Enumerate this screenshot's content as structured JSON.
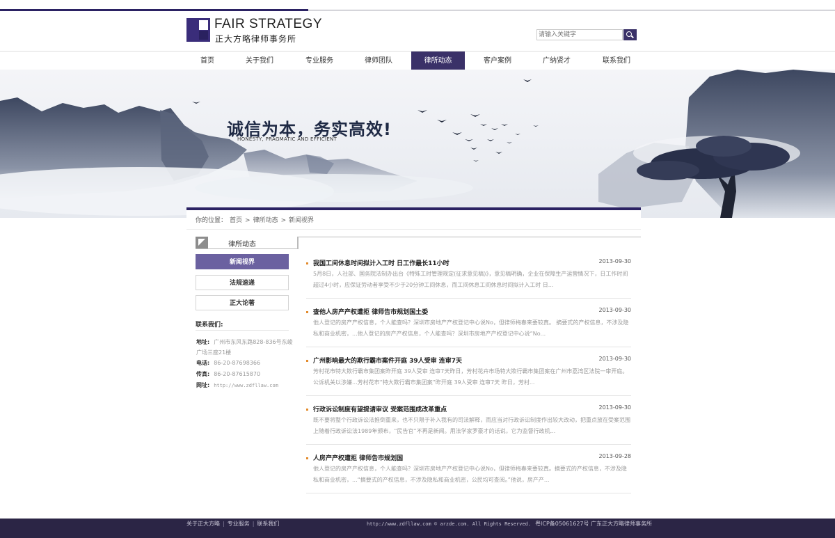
{
  "header": {
    "logo_en": "FAIR STRATEGY",
    "logo_cn": "正大方略律师事务所",
    "search_placeholder": "请输入关键字"
  },
  "nav": {
    "items": [
      "首页",
      "关于我们",
      "专业服务",
      "律师团队",
      "律所动态",
      "客户案例",
      "广纳贤才",
      "联系我们"
    ],
    "active": "律所动态"
  },
  "banner": {
    "slogan": "诚信为本，务实高效!",
    "slogan_en": "HONESTY, PRAGMATIC AND EFFICIENT"
  },
  "breadcrumb": [
    "你的位置：",
    "首页",
    ">",
    "律所动态",
    ">",
    "新闻视界"
  ],
  "sidebar": {
    "title": "律所动态",
    "items": [
      "新闻视界",
      "法规速递",
      "正大论著"
    ],
    "active": "新闻视界",
    "contact": {
      "title": "联系我们:",
      "address_label": "地址:",
      "address": "广州市东风东路828-836号东峻广场三座21楼",
      "phone_label": "电话:",
      "phone": "86-20-87698366",
      "fax_label": "传真:",
      "fax": "86-20-87615870",
      "web_label": "网址:",
      "web": "http://www.zdfllaw.com"
    }
  },
  "news": [
    {
      "title": "我国工间休息时间拟计入工时  日工作最长11小时",
      "date": "2013-09-30",
      "summary": "5月8日，人社部、国务院法制办出台《特殊工时管理规定(征求意见稿)》，意见稿明确，企业在保障生产运营情况下，日工作时间超过4小时，应保证劳动者享受不少于20分钟工间休息，而工间休息工间休息时间拟计入工时 日..."
    },
    {
      "title": "查他人房产产权遭拒  律师告市规划国土委",
      "date": "2013-09-30",
      "summary": "他人登记的房产产权信息，个人能查吗？深圳市房地产产权登记中心说No，但律师梅春来要较真。     摘要式的产权信息，不涉及隐私和商业机密，...他人登记的房产产权信息，个人能查吗？深圳市房地产产权登记中心说“No..."
    },
    {
      "title": "广州影响最大的欺行霸市案件开庭  39人受审  连审7天",
      "date": "2013-09-30",
      "summary": "芳村花市特大欺行霸市集团案昨开庭 39人受审 连审7天昨日，芳村花卉市场特大欺行霸市集团案在广州市荔湾区法院一审开庭。公诉机关以涉嫌...芳村花市“特大欺行霸市集团案”昨开庭 39人受审 连审7天 昨日，芳村..."
    },
    {
      "title": "行政诉讼制度有望提请审议  受案范围成改革重点",
      "date": "2013-09-30",
      "summary": "既不要将整个行政诉讼法推倒重来，也不只限于补入我有的司法解释，而应当对行政诉讼制度作出较大改动，把重点放在受案范围上随着行政诉讼法1989年颁布，“民告官”不再是新闻。用法学家罗豪才的话说，它为监督行政机..."
    },
    {
      "title": "人房产产权遭拒  律师告市规划国",
      "date": "2013-09-28",
      "summary": "他人登记的房产产权信息，个人能查吗？深圳市房地产产权登记中心说No，但律师梅春来要较真。摘要式的产权信息，不涉及隐私和商业机密，...“摘要式的产权信息，不涉及隐私和商业机密，公民均可查阅。”他说，房产产..."
    }
  ],
  "footer": {
    "links": [
      "关于正大方略",
      "专业服务",
      "联系我们"
    ],
    "copyright": "http://www.zdfllaw.com © arzde.com. All Rights Reserved.",
    "icp": "粤ICP备05061627号  广东正大方略律师事务所"
  },
  "colors": {
    "brand": "#2b2263",
    "nav_active": "#3a3168",
    "side_active": "#6b61a0",
    "bullet": "#e38b2c",
    "footer_bg": "#2b2545"
  }
}
